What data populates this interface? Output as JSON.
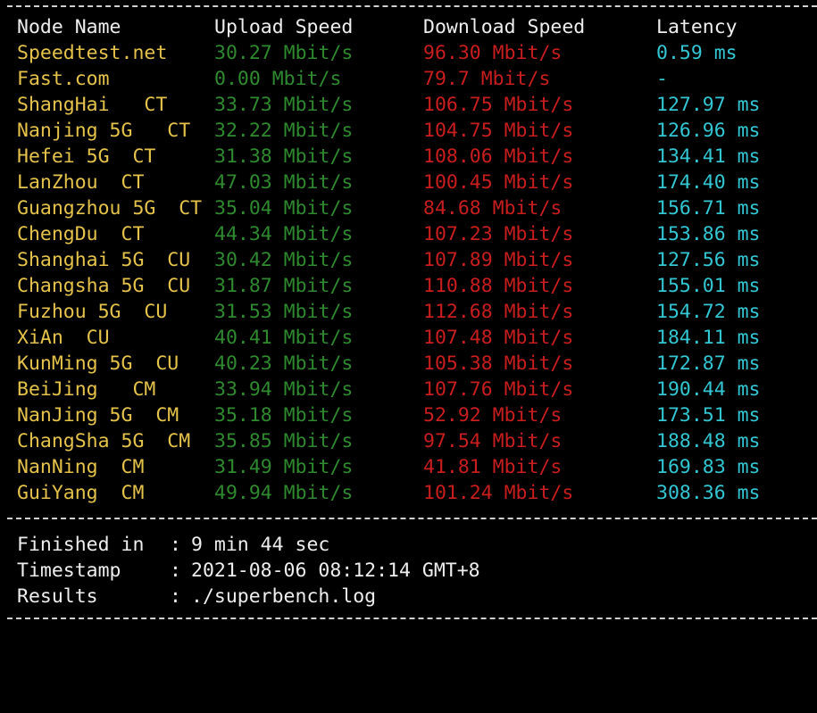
{
  "header": {
    "node_name": "Node Name",
    "upload_speed": "Upload Speed",
    "download_speed": "Download Speed",
    "latency": "Latency"
  },
  "colors": {
    "node": "#e5c34b",
    "upload": "#2f8a2f",
    "download": "#c81e1e",
    "latency": "#33c7d3",
    "text": "#eeeeee",
    "background": "#000000"
  },
  "rows": [
    {
      "node": "Speedtest.net",
      "upload": "30.27 Mbit/s",
      "download": "96.30 Mbit/s",
      "latency": "0.59 ms"
    },
    {
      "node": "Fast.com",
      "upload": "0.00 Mbit/s",
      "download": "79.7 Mbit/s",
      "latency": "-"
    },
    {
      "node": "ShangHai   CT",
      "upload": "33.73 Mbit/s",
      "download": "106.75 Mbit/s",
      "latency": "127.97 ms"
    },
    {
      "node": "Nanjing 5G   CT",
      "upload": "32.22 Mbit/s",
      "download": "104.75 Mbit/s",
      "latency": "126.96 ms"
    },
    {
      "node": "Hefei 5G  CT",
      "upload": "31.38 Mbit/s",
      "download": "108.06 Mbit/s",
      "latency": "134.41 ms"
    },
    {
      "node": "LanZhou  CT",
      "upload": "47.03 Mbit/s",
      "download": "100.45 Mbit/s",
      "latency": "174.40 ms"
    },
    {
      "node": "Guangzhou 5G  CT",
      "upload": "35.04 Mbit/s",
      "download": "84.68 Mbit/s",
      "latency": "156.71 ms"
    },
    {
      "node": "ChengDu  CT",
      "upload": "44.34 Mbit/s",
      "download": "107.23 Mbit/s",
      "latency": "153.86 ms"
    },
    {
      "node": "Shanghai 5G  CU",
      "upload": "30.42 Mbit/s",
      "download": "107.89 Mbit/s",
      "latency": "127.56 ms"
    },
    {
      "node": "Changsha 5G  CU",
      "upload": "31.87 Mbit/s",
      "download": "110.88 Mbit/s",
      "latency": "155.01 ms"
    },
    {
      "node": "Fuzhou 5G  CU",
      "upload": "31.53 Mbit/s",
      "download": "112.68 Mbit/s",
      "latency": "154.72 ms"
    },
    {
      "node": "XiAn  CU",
      "upload": "40.41 Mbit/s",
      "download": "107.48 Mbit/s",
      "latency": "184.11 ms"
    },
    {
      "node": "KunMing 5G  CU",
      "upload": "40.23 Mbit/s",
      "download": "105.38 Mbit/s",
      "latency": "172.87 ms"
    },
    {
      "node": "BeiJing   CM",
      "upload": "33.94 Mbit/s",
      "download": "107.76 Mbit/s",
      "latency": "190.44 ms"
    },
    {
      "node": "NanJing 5G  CM",
      "upload": "35.18 Mbit/s",
      "download": "52.92 Mbit/s",
      "latency": "173.51 ms"
    },
    {
      "node": "ChangSha 5G  CM",
      "upload": "35.85 Mbit/s",
      "download": "97.54 Mbit/s",
      "latency": "188.48 ms"
    },
    {
      "node": "NanNing  CM",
      "upload": "31.49 Mbit/s",
      "download": "41.81 Mbit/s",
      "latency": "169.83 ms"
    },
    {
      "node": "GuiYang  CM",
      "upload": "49.94 Mbit/s",
      "download": "101.24 Mbit/s",
      "latency": "308.36 ms"
    }
  ],
  "footer": {
    "finished_label": "Finished in",
    "finished_value": "9 min 44 sec",
    "timestamp_label": "Timestamp",
    "timestamp_value": "2021-08-06 08:12:14 GMT+8",
    "results_label": "Results",
    "results_value": "./superbench.log",
    "colon": ":"
  }
}
